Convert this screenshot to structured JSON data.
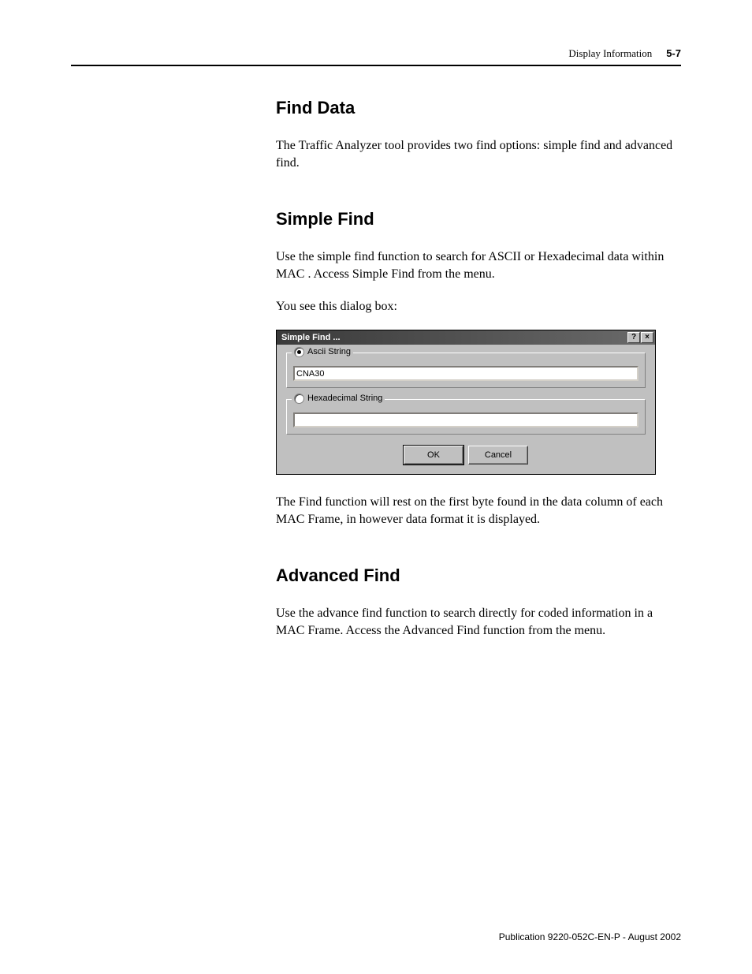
{
  "header": {
    "section": "Display Information",
    "page_num": "5-7"
  },
  "sections": {
    "find_data": {
      "title": "Find Data",
      "p1": "The Traffic Analyzer tool provides two find options: simple find and advanced find."
    },
    "simple_find": {
      "title": "Simple Find",
      "p1": "Use the simple find function to search for ASCII or Hexadecimal data within MAC                              . Access Simple Find from the         menu.",
      "p2": "You see this dialog box:",
      "p3": "The Find function will rest on the first byte found in the data column of each MAC Frame, in however data format it is displayed."
    },
    "advanced_find": {
      "title": "Advanced Find",
      "p1": "Use the advance find function to search directly for coded information in a MAC Frame. Access the Advanced Find function from the           menu."
    }
  },
  "dialog": {
    "title": "Simple Find ...",
    "help_btn": "?",
    "close_btn": "×",
    "ascii_label": "Ascii String",
    "ascii_value": "CNA30",
    "hex_label": "Hexadecimal String",
    "hex_value": "",
    "ok": "OK",
    "cancel": "Cancel"
  },
  "footer": {
    "text": "Publication 9220-052C-EN-P - August 2002"
  }
}
